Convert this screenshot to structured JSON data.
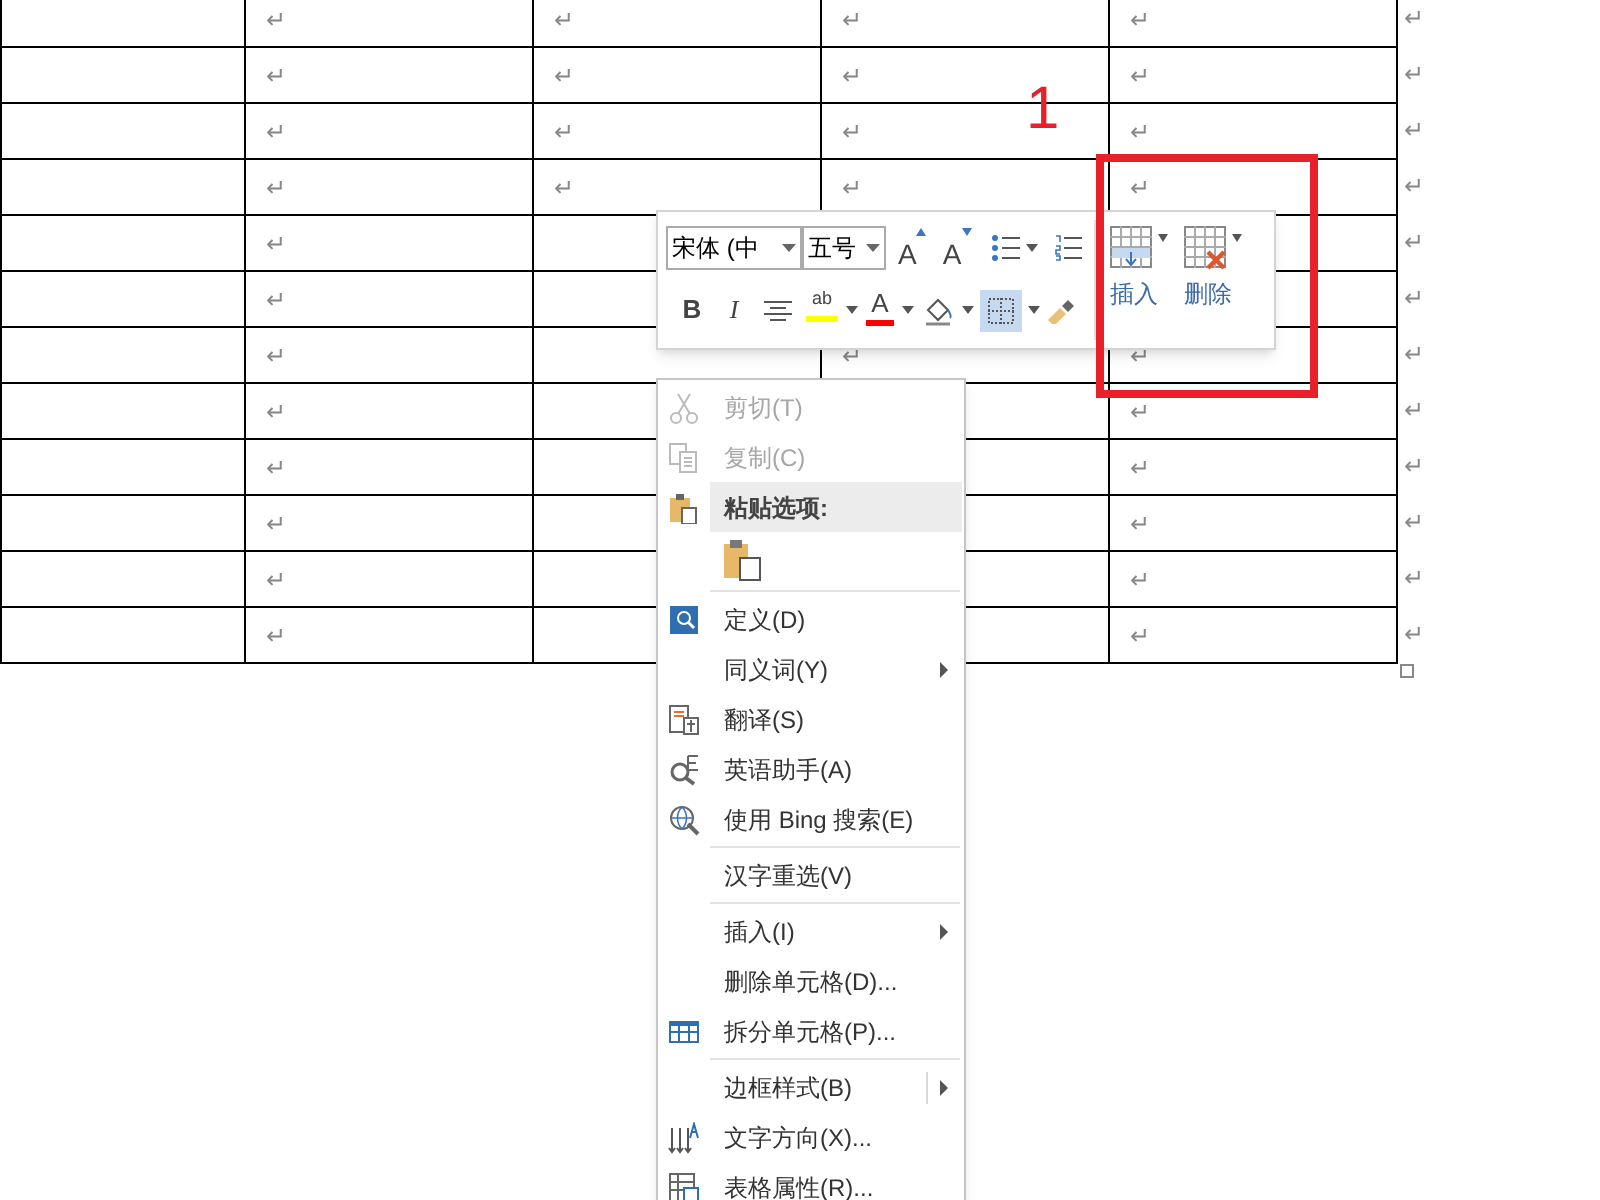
{
  "table": {
    "rows": [
      {
        "cells": [
          "↵",
          "↵",
          "↵",
          "↵"
        ],
        "end_mark": "↵"
      },
      {
        "cells": [
          "↵",
          "↵",
          "↵",
          "↵"
        ],
        "end_mark": "↵"
      },
      {
        "cells": [
          "↵",
          "↵",
          "↵",
          "↵"
        ],
        "end_mark": "↵"
      },
      {
        "cells": [
          "↵",
          "↵",
          "↵",
          "↵"
        ],
        "end_mark": "↵"
      },
      {
        "cells": [
          "↵",
          null,
          null,
          null
        ],
        "end_mark": "↵"
      },
      {
        "cells": [
          "↵",
          null,
          null,
          null
        ],
        "end_mark": "↵"
      },
      {
        "cells": [
          "↵",
          null,
          "↵",
          "↵"
        ],
        "end_mark": "↵"
      },
      {
        "cells": [
          "↵",
          null,
          null,
          "↵"
        ],
        "end_mark": "↵"
      },
      {
        "cells": [
          "↵",
          null,
          null,
          "↵"
        ],
        "end_mark": "↵"
      },
      {
        "cells": [
          "↵",
          null,
          null,
          "↵"
        ],
        "end_mark": "↵"
      },
      {
        "cells": [
          "↵",
          null,
          null,
          "↵"
        ],
        "end_mark": "↵"
      },
      {
        "cells": [
          "↵",
          null,
          null,
          "↵"
        ],
        "end_mark": "↵"
      }
    ]
  },
  "annotation": {
    "number": "1"
  },
  "mini_toolbar": {
    "font": "宋体 (中",
    "size": "五号",
    "row1": [
      {
        "kind": "grow-font",
        "label": "A"
      },
      {
        "kind": "shrink-font",
        "label": "A"
      },
      {
        "kind": "bullets"
      },
      {
        "kind": "numbering"
      }
    ],
    "row2": [
      {
        "kind": "bold",
        "label": "B"
      },
      {
        "kind": "italic",
        "label": "I"
      },
      {
        "kind": "center"
      },
      {
        "kind": "highlight",
        "label": "ab"
      },
      {
        "kind": "font-color",
        "label": "A"
      },
      {
        "kind": "shading"
      },
      {
        "kind": "borders",
        "selected": true
      },
      {
        "kind": "painter"
      }
    ],
    "insert": "插入",
    "delete": "删除"
  },
  "context_menu": [
    {
      "kind": "item",
      "label": "剪切(T)",
      "disabled": true
    },
    {
      "kind": "item",
      "label": "复制(C)",
      "disabled": true
    },
    {
      "kind": "header",
      "label": "粘贴选项:"
    },
    {
      "kind": "paste-options"
    },
    {
      "kind": "separator"
    },
    {
      "kind": "item",
      "label": "定义(D)",
      "disabled": false
    },
    {
      "kind": "item",
      "label": "同义词(Y)",
      "disabled": false,
      "submenu": true
    },
    {
      "kind": "item",
      "label": "翻译(S)",
      "disabled": false
    },
    {
      "kind": "item",
      "label": "英语助手(A)",
      "disabled": false
    },
    {
      "kind": "item",
      "label": "使用 Bing 搜索(E)",
      "disabled": false
    },
    {
      "kind": "separator"
    },
    {
      "kind": "item",
      "label": "汉字重选(V)",
      "disabled": false
    },
    {
      "kind": "separator"
    },
    {
      "kind": "item",
      "label": "插入(I)",
      "disabled": false,
      "submenu": true
    },
    {
      "kind": "item",
      "label": "删除单元格(D)...",
      "disabled": false
    },
    {
      "kind": "item",
      "label": "拆分单元格(P)...",
      "disabled": false
    },
    {
      "kind": "separator"
    },
    {
      "kind": "item",
      "label": "边框样式(B)",
      "disabled": false,
      "submenu": true,
      "split": true
    },
    {
      "kind": "item",
      "label": "文字方向(X)...",
      "disabled": false
    },
    {
      "kind": "item",
      "label": "表格属性(R)...",
      "disabled": false
    }
  ]
}
